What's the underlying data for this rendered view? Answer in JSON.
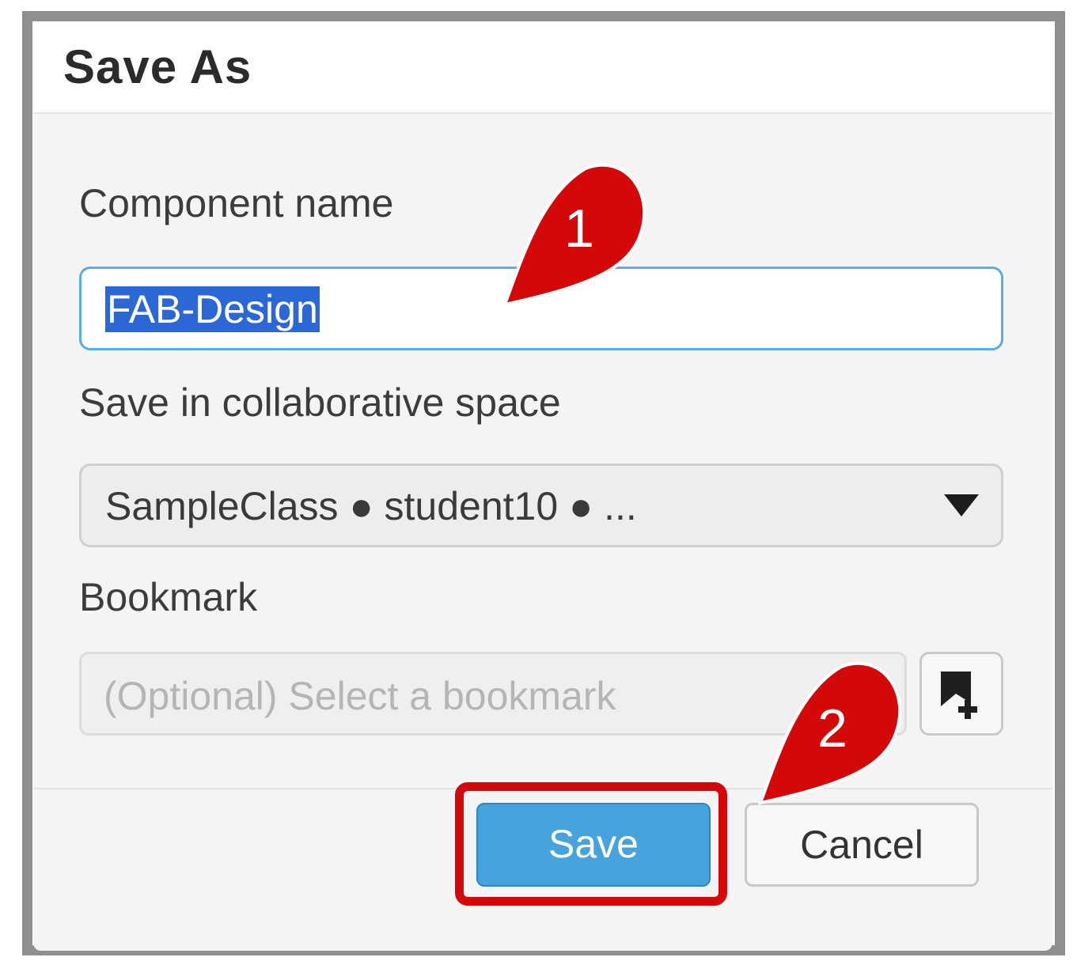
{
  "dialog": {
    "title": "Save As"
  },
  "form": {
    "component_name_label": "Component name",
    "component_name_value": "FAB-Design",
    "collab_space_label": "Save in collaborative space",
    "collab_space_value": "SampleClass ● student10 ● ...",
    "bookmark_label": "Bookmark",
    "bookmark_placeholder": "(Optional) Select a bookmark"
  },
  "footer": {
    "save_label": "Save",
    "cancel_label": "Cancel"
  },
  "callouts": {
    "first": "1",
    "second": "2"
  },
  "icons": {
    "dropdown": "triangle-down-icon",
    "bookmark_add": "bookmark-add-icon"
  },
  "colors": {
    "accent": "#46a3dc",
    "callout": "#d40808",
    "selection": "#2c67d6"
  }
}
